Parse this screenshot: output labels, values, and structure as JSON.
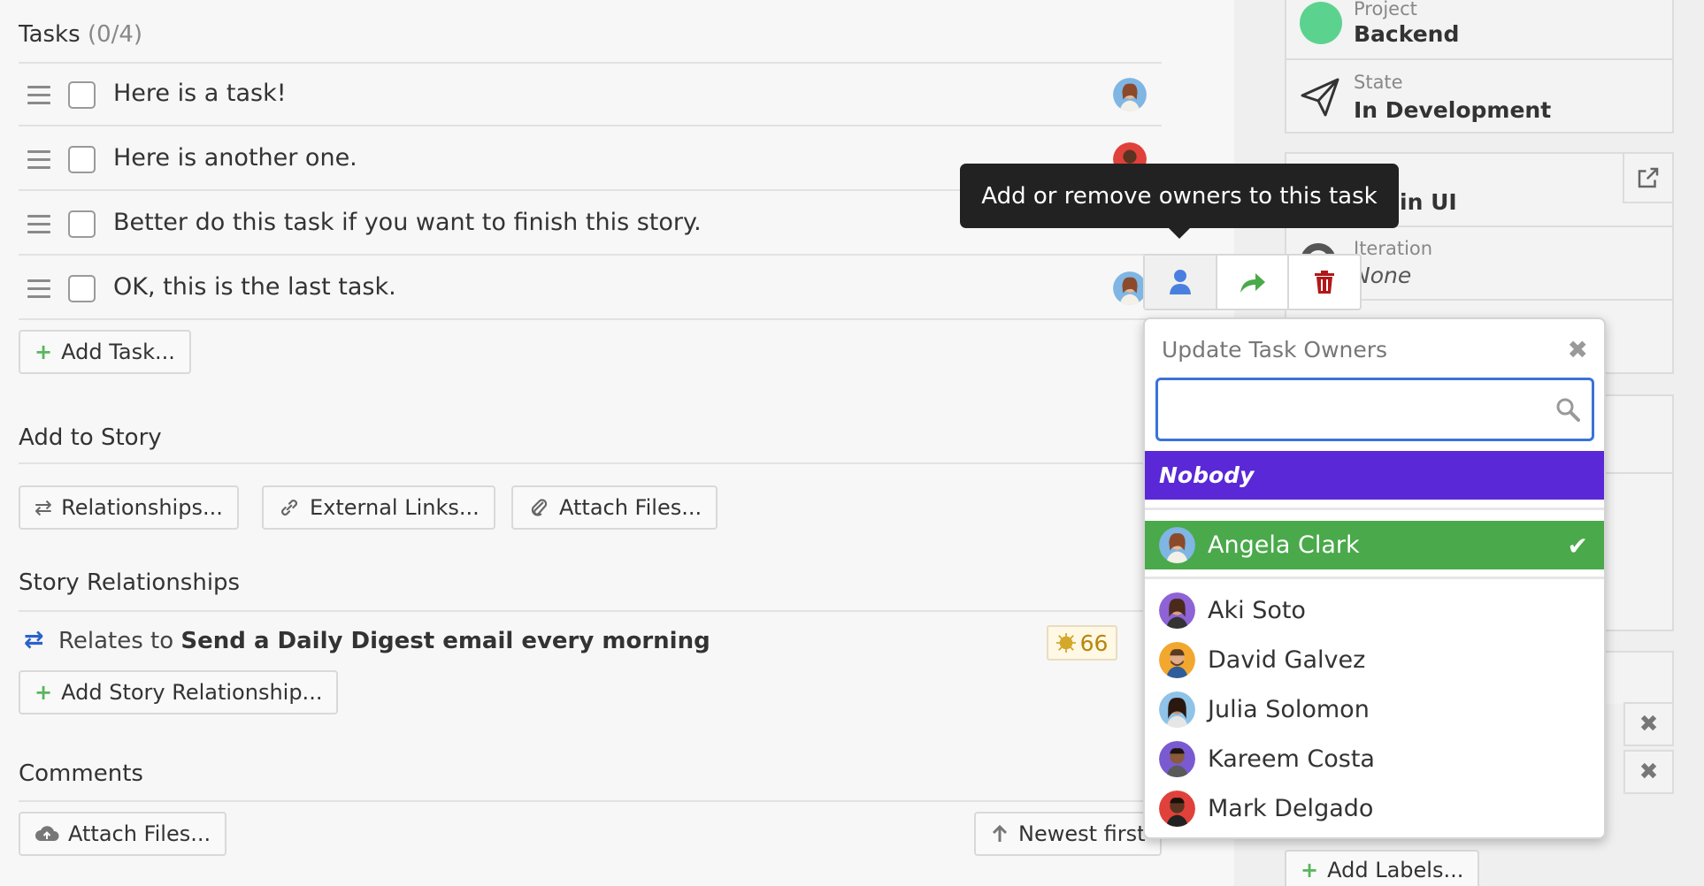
{
  "tasks": {
    "title": "Tasks",
    "count": "(0/4)",
    "items": [
      {
        "text": "Here is a task!"
      },
      {
        "text": "Here is another one."
      },
      {
        "text": "Better do this task if you want to finish this story."
      },
      {
        "text": "OK, this is the last task."
      }
    ],
    "add_label": "Add Task..."
  },
  "add_to_story": {
    "title": "Add to Story",
    "relationships_label": "Relationships...",
    "external_links_label": "External Links...",
    "attach_files_label": "Attach Files..."
  },
  "story_relationships": {
    "title": "Story Relationships",
    "relation_prefix": "Relates to",
    "relation_story": "Send a Daily Digest email every morning",
    "points": "66",
    "add_label": "Add Story Relationship..."
  },
  "comments": {
    "title": "Comments",
    "attach_label": "Attach Files...",
    "sort_label": "Newest first"
  },
  "sidebar": {
    "project_label": "Project",
    "project_value": "Backend",
    "project_color": "#5bd38f",
    "state_label": "State",
    "state_value": "In Development",
    "epic_value_partial": "in UI",
    "iteration_label": "Iteration",
    "iteration_value_partial": "None",
    "add_labels": "Add Labels..."
  },
  "tooltip": {
    "text": "Add or remove owners to this task"
  },
  "owners_popover": {
    "title": "Update Task Owners",
    "search_placeholder": "",
    "nobody_label": "Nobody",
    "selected_owner": "Angela Clark",
    "owners": [
      "Aki Soto",
      "David Galvez",
      "Julia Solomon",
      "Kareem Costa",
      "Mark Delgado"
    ]
  },
  "colors": {
    "nobody_bg": "#5a28d6",
    "selected_bg": "#4aa94a",
    "tooltip_bg": "#222222",
    "search_border": "#3a73d9",
    "delete_icon": "#b21818",
    "convert_icon": "#4aa94a",
    "owner_icon": "#4a7fe0"
  },
  "icons": {
    "close": "✖",
    "check": "✔",
    "plus": "+",
    "relationship": "⇄",
    "link": "🔗",
    "paperclip": "📎"
  }
}
